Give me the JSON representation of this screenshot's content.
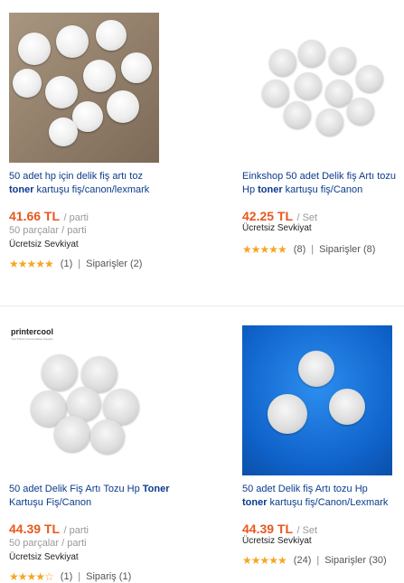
{
  "products": [
    {
      "title_before": "50 adet hp için delik fiş artı toz",
      "title_bold": "toner",
      "title_after": " kartuşu fiş/canon/lexmark",
      "price": "41.66 TL",
      "unit": "/ parti",
      "lots": "50 parçalar / parti",
      "shipping": "Ücretsiz Sevkiyat",
      "stars": "★★★★★",
      "reviews": "(1)",
      "orders": "Siparişler (2)"
    },
    {
      "title_before": "Einkshop 50 adet Delik fiş Artı tozu Hp ",
      "title_bold": "toner",
      "title_after": " kartuşu fiş/Canon",
      "price": "42.25 TL",
      "unit": "/ Set",
      "lots": "",
      "shipping": "Ücretsiz Sevkiyat",
      "stars": "★★★★★",
      "reviews": "(8)",
      "orders": "Siparişler (8)"
    },
    {
      "title_before": "50 adet Delik Fiş Artı Tozu Hp ",
      "title_bold": "Toner",
      "title_after": " Kartuşu Fiş/Canon",
      "price": "44.39 TL",
      "unit": "/ parti",
      "lots": "50 parçalar / parti",
      "shipping": "Ücretsiz Sevkiyat",
      "stars": "★★★★☆",
      "reviews": "(1)",
      "orders": "Sipariş (1)",
      "logo_text": "printercool",
      "logo_sub": "Your Printer Consumables Supplier"
    },
    {
      "title_before": "50 adet Delik fiş Artı tozu Hp ",
      "title_bold": "toner",
      "title_after": " kartuşu fiş/Canon/Lexmark",
      "price": "44.39 TL",
      "unit": "/ Set",
      "lots": "",
      "shipping": "Ücretsiz Sevkiyat",
      "stars": "★★★★★",
      "reviews": "(24)",
      "orders": "Siparişler (30)"
    }
  ],
  "colors": {
    "price": "#e8581e",
    "title_link": "#0b3b8c",
    "star": "#f5a623"
  }
}
